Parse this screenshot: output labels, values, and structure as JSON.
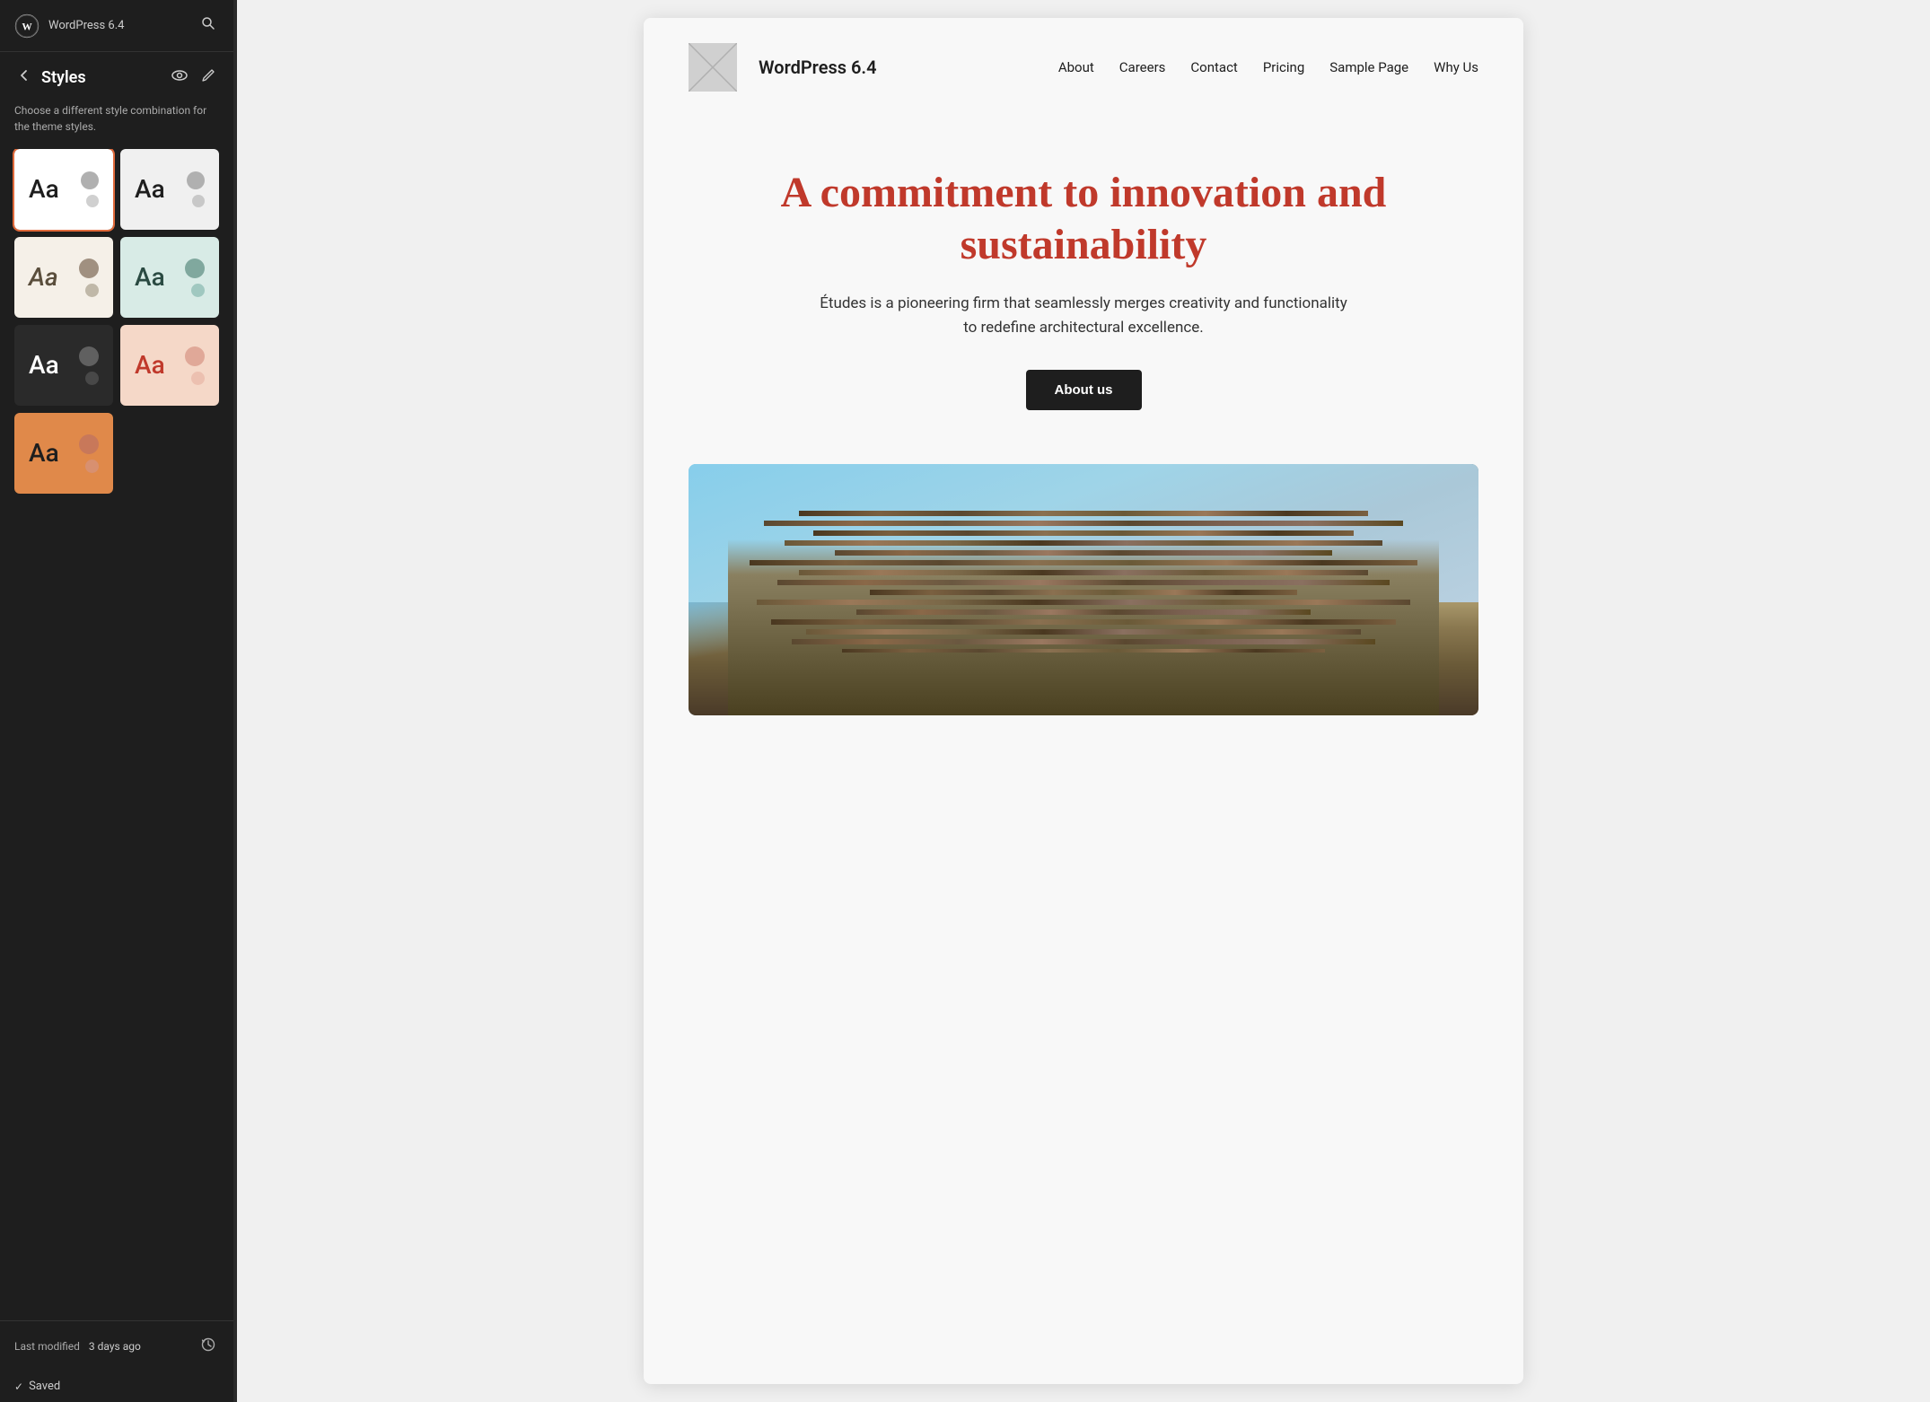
{
  "app": {
    "title": "WordPress 6.4",
    "search_aria": "Search"
  },
  "sidebar": {
    "title": "WordPress 6.4",
    "back_aria": "Back",
    "styles_title": "Styles",
    "description": "Choose a different style combination for the theme styles.",
    "preview_icon_aria": "Preview",
    "edit_icon_aria": "Edit",
    "style_cards": [
      {
        "id": "card-white",
        "variant": "card-white",
        "aa_text": "Aa",
        "selected": true
      },
      {
        "id": "card-light-gray",
        "variant": "card-light-gray",
        "aa_text": "Aa",
        "selected": false
      },
      {
        "id": "card-cream",
        "variant": "card-cream",
        "aa_text": "Aa",
        "selected": false
      },
      {
        "id": "card-mint",
        "variant": "card-mint",
        "aa_text": "Aa",
        "selected": false
      },
      {
        "id": "card-dark",
        "variant": "card-dark",
        "aa_text": "Aa",
        "selected": false
      },
      {
        "id": "card-peach",
        "variant": "card-peach",
        "aa_text": "Aa",
        "selected": false
      },
      {
        "id": "card-orange",
        "variant": "card-orange",
        "aa_text": "Aa",
        "selected": false
      }
    ],
    "footer": {
      "last_modified_label": "Last modified",
      "last_modified_value": "3 days ago",
      "history_aria": "Revision history"
    },
    "saved_label": "Saved"
  },
  "preview": {
    "site_logo_alt": "Site logo",
    "site_name": "WordPress 6.4",
    "nav_links": [
      {
        "label": "About"
      },
      {
        "label": "Careers"
      },
      {
        "label": "Contact"
      },
      {
        "label": "Pricing"
      },
      {
        "label": "Sample Page"
      },
      {
        "label": "Why Us"
      }
    ],
    "hero_title": "A commitment to innovation and sustainability",
    "hero_subtitle": "Études is a pioneering firm that seamlessly merges creativity and functionality to redefine architectural excellence.",
    "about_us_btn": "About us",
    "building_image_alt": "Architectural building exterior"
  }
}
